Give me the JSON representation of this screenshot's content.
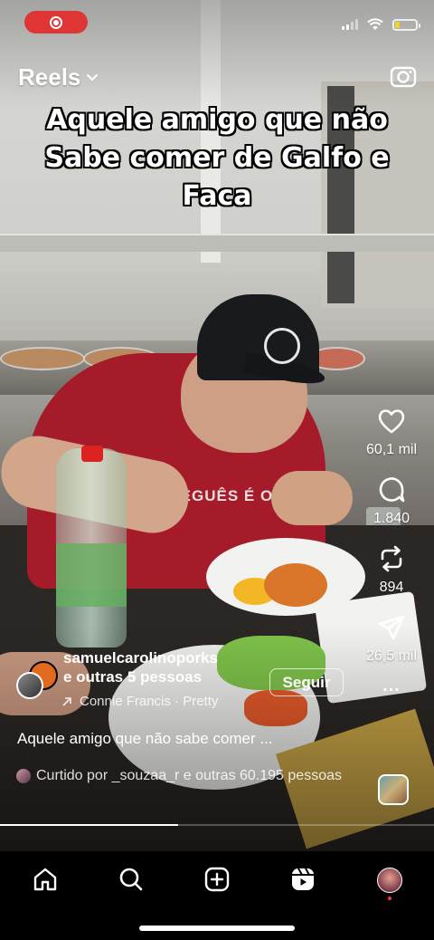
{
  "status_bar": {
    "recording_indicator": "record-icon",
    "battery_level": 0.2,
    "battery_color": "#f2d32c"
  },
  "header": {
    "title": "Reels",
    "title_icon": "chevron-down-icon",
    "camera_icon": "camera-icon"
  },
  "video": {
    "caption_line1": "Aquele amigo que não",
    "caption_line2": "Sabe comer de Galfo e",
    "caption_line3": "Faca",
    "shirt_print": "FREGUÊS É O",
    "progress": 0.41
  },
  "actions": {
    "likes": "60,1 mil",
    "comments": "1.840",
    "reposts": "894",
    "shares": "26,5 mil",
    "more": "..."
  },
  "author": {
    "name": "samuelcarolinoporks",
    "collaborators": "e outras 5 pessoas",
    "follow_label": "Seguir",
    "audio": "Connie Francis · Pretty"
  },
  "description": "Aquele amigo que não sabe comer ...",
  "liked_by": "Curtido por _souzaa_r e outras 60.195 pessoas",
  "colors": {
    "record_pill": "#e03535",
    "notification_dot": "#ff3040"
  },
  "tabs": [
    "home-icon",
    "search-icon",
    "create-icon",
    "reels-icon",
    "profile-avatar"
  ]
}
